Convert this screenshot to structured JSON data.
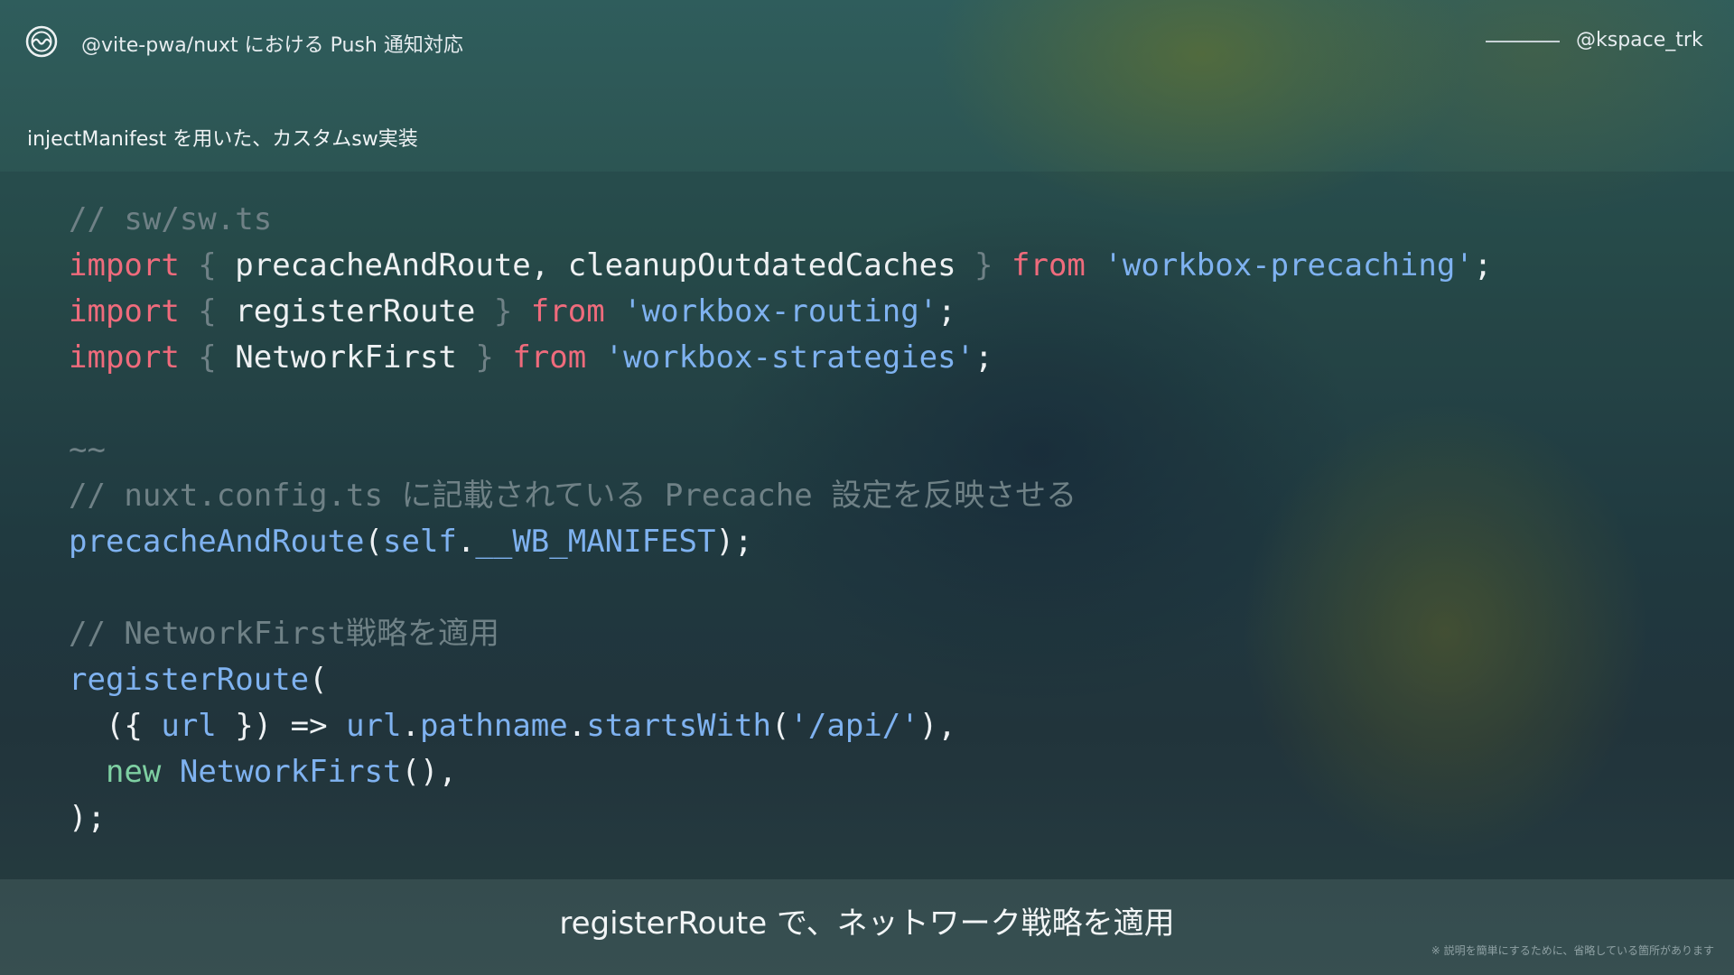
{
  "header": {
    "logo_icon": "wave-circle-logo-icon",
    "deck_title": "@vite-pwa/nuxt における Push 通知対応",
    "author": "@kspace_trk"
  },
  "section": {
    "title": "injectManifest を用いた、カスタムsw実装"
  },
  "code": {
    "language": "typescript",
    "lines": [
      [
        {
          "t": "// sw/sw.ts",
          "c": "comment"
        }
      ],
      [
        {
          "t": "import",
          "c": "kw"
        },
        {
          "t": " { ",
          "c": "brace"
        },
        {
          "t": "precacheAndRoute, cleanupOutdatedCaches",
          "c": "id"
        },
        {
          "t": " } ",
          "c": "brace"
        },
        {
          "t": "from",
          "c": "kw"
        },
        {
          "t": " ",
          "c": "plain"
        },
        {
          "t": "'workbox-precaching'",
          "c": "str"
        },
        {
          "t": ";",
          "c": "plain"
        }
      ],
      [
        {
          "t": "import",
          "c": "kw"
        },
        {
          "t": " { ",
          "c": "brace"
        },
        {
          "t": "registerRoute",
          "c": "id"
        },
        {
          "t": " } ",
          "c": "brace"
        },
        {
          "t": "from",
          "c": "kw"
        },
        {
          "t": " ",
          "c": "plain"
        },
        {
          "t": "'workbox-routing'",
          "c": "str"
        },
        {
          "t": ";",
          "c": "plain"
        }
      ],
      [
        {
          "t": "import",
          "c": "kw"
        },
        {
          "t": " { ",
          "c": "brace"
        },
        {
          "t": "NetworkFirst",
          "c": "id"
        },
        {
          "t": " } ",
          "c": "brace"
        },
        {
          "t": "from",
          "c": "kw"
        },
        {
          "t": " ",
          "c": "plain"
        },
        {
          "t": "'workbox-strategies'",
          "c": "str"
        },
        {
          "t": ";",
          "c": "plain"
        }
      ],
      [],
      [
        {
          "t": "~~",
          "c": "comment"
        }
      ],
      [
        {
          "t": "// nuxt.config.ts に記載されている Precache 設定を反映させる",
          "c": "comment"
        }
      ],
      [
        {
          "t": "precacheAndRoute",
          "c": "fn"
        },
        {
          "t": "(",
          "c": "plain"
        },
        {
          "t": "self",
          "c": "fn"
        },
        {
          "t": ".",
          "c": "plain"
        },
        {
          "t": "__WB_MANIFEST",
          "c": "fn"
        },
        {
          "t": ");",
          "c": "plain"
        }
      ],
      [],
      [
        {
          "t": "// NetworkFirst戦略を適用",
          "c": "comment"
        }
      ],
      [
        {
          "t": "registerRoute",
          "c": "fn"
        },
        {
          "t": "(",
          "c": "plain"
        }
      ],
      [
        {
          "t": "  ({ ",
          "c": "plain"
        },
        {
          "t": "url",
          "c": "fn"
        },
        {
          "t": " }) => ",
          "c": "plain"
        },
        {
          "t": "url",
          "c": "fn"
        },
        {
          "t": ".",
          "c": "plain"
        },
        {
          "t": "pathname",
          "c": "fn"
        },
        {
          "t": ".",
          "c": "plain"
        },
        {
          "t": "startsWith",
          "c": "fn"
        },
        {
          "t": "(",
          "c": "plain"
        },
        {
          "t": "'/api/'",
          "c": "str"
        },
        {
          "t": "),",
          "c": "plain"
        }
      ],
      [
        {
          "t": "  ",
          "c": "plain"
        },
        {
          "t": "new",
          "c": "new"
        },
        {
          "t": " ",
          "c": "plain"
        },
        {
          "t": "NetworkFirst",
          "c": "fn"
        },
        {
          "t": "(),",
          "c": "plain"
        }
      ],
      [
        {
          "t": ");",
          "c": "plain"
        }
      ]
    ]
  },
  "footer": {
    "caption": "registerRoute で、ネットワーク戦略を適用",
    "note": "※ 説明を簡単にするために、省略している箇所があります"
  }
}
